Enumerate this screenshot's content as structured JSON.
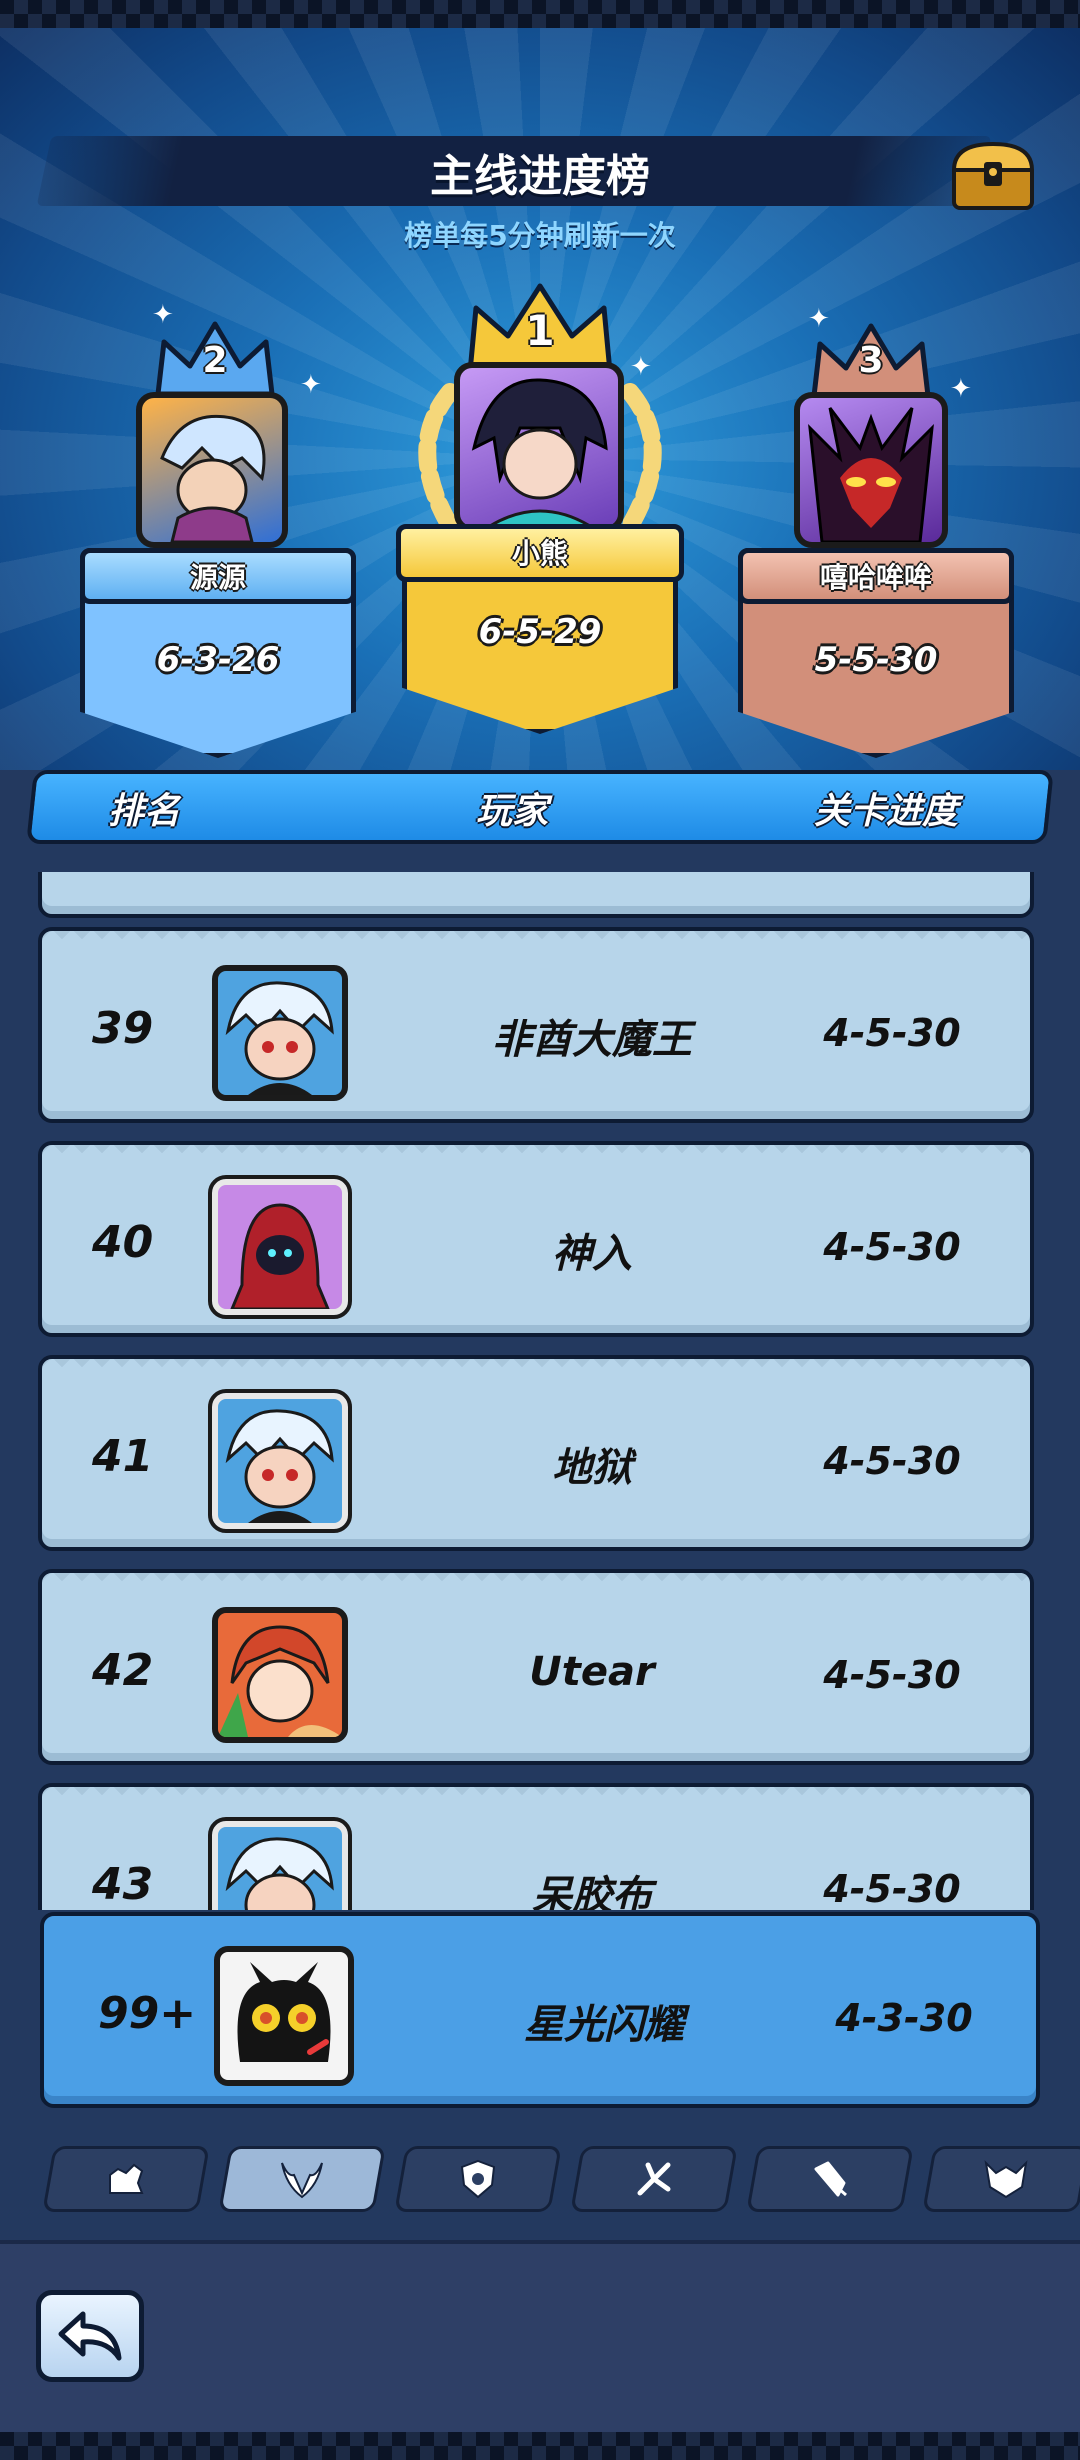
{
  "header": {
    "title": "主线进度榜",
    "subtitle": "榜单每5分钟刷新一次"
  },
  "podium": [
    {
      "rank": "2",
      "name": "源源",
      "progress": "6-3-26"
    },
    {
      "rank": "1",
      "name": "小熊",
      "progress": "6-5-29"
    },
    {
      "rank": "3",
      "name": "嘻哈哞哞",
      "progress": "5-5-30"
    }
  ],
  "columns": {
    "rank": "排名",
    "player": "玩家",
    "progress": "关卡进度"
  },
  "rows": [
    {
      "rank": "39",
      "name": "非酋大魔王",
      "progress": "4-5-30"
    },
    {
      "rank": "40",
      "name": "神入",
      "progress": "4-5-30"
    },
    {
      "rank": "41",
      "name": "地狱",
      "progress": "4-5-30"
    },
    {
      "rank": "42",
      "name": "Utear",
      "progress": "4-5-30"
    },
    {
      "rank": "43",
      "name": "呆胶布",
      "progress": "4-5-30"
    }
  ],
  "self": {
    "rank": "99+",
    "name": "星光闪耀",
    "progress": "4-3-30"
  },
  "tabs": [
    {
      "icon": "hand-icon",
      "active": false
    },
    {
      "icon": "demon-icon",
      "active": true
    },
    {
      "icon": "shield-icon",
      "active": false
    },
    {
      "icon": "branch-icon",
      "active": false
    },
    {
      "icon": "feather-icon",
      "active": false
    },
    {
      "icon": "helmet-icon",
      "active": false
    }
  ],
  "footer": {
    "back_icon": "back-arrow-icon"
  },
  "colors": {
    "gold": "#f5c83a",
    "silver": "#7fc2ff",
    "bronze": "#d28f7a",
    "row_bg": "#b7d5ea",
    "self_bg": "#4b9fe6",
    "header_blue": "#2f9ede"
  }
}
